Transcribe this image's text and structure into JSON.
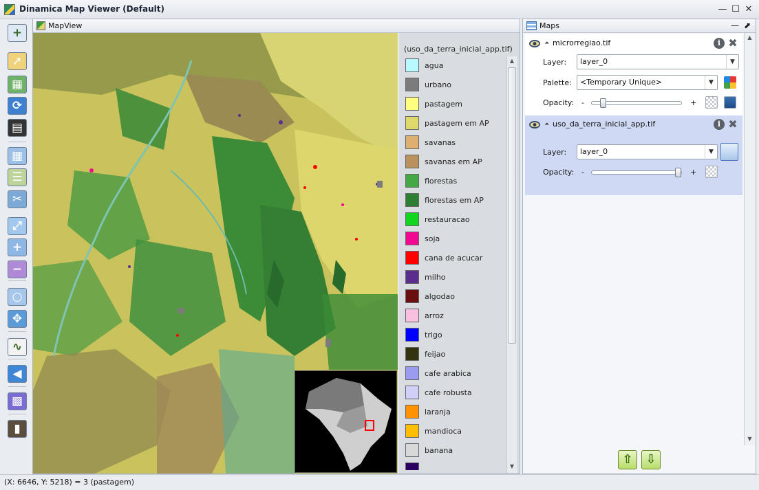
{
  "window": {
    "title": "Dinamica Map Viewer (Default)",
    "minimize_glyph": "—",
    "maximize_glyph": "☐",
    "close_glyph": "✕"
  },
  "toolbar": [
    {
      "name": "new-map-icon",
      "color": "#dfe9f5",
      "glyph": "+"
    },
    {
      "name": "open-map-icon",
      "color": "#f1d27c",
      "glyph": "➚"
    },
    {
      "name": "map-properties-icon",
      "color": "#6fb26a",
      "glyph": "▦"
    },
    {
      "name": "refresh-icon",
      "color": "#3d80cf",
      "glyph": "⟳"
    },
    {
      "name": "animation-icon",
      "color": "#333333",
      "glyph": "▤"
    },
    {
      "name": "grid-icon",
      "color": "#9cc0e8",
      "glyph": "▦"
    },
    {
      "name": "legend-icon",
      "color": "#bed39a",
      "glyph": "☰"
    },
    {
      "name": "tools-icon",
      "color": "#7ca9d6",
      "glyph": "✂"
    },
    {
      "name": "zoom-extent-icon",
      "color": "#a3c8ee",
      "glyph": "⤢"
    },
    {
      "name": "zoom-in-icon",
      "color": "#8fb7e6",
      "glyph": "+"
    },
    {
      "name": "zoom-out-icon",
      "color": "#b08ad6",
      "glyph": "−"
    },
    {
      "name": "zoom-tool-icon",
      "color": "#a6c7ea",
      "glyph": "○"
    },
    {
      "name": "pan-icon",
      "color": "#5a9bd8",
      "glyph": "✥"
    },
    {
      "name": "graph-icon",
      "color": "#f2f2f2",
      "glyph": "∿"
    },
    {
      "name": "back-icon",
      "color": "#3f86d6",
      "glyph": "◀"
    },
    {
      "name": "palette-icon",
      "color": "#7a6cd3",
      "glyph": "▩"
    },
    {
      "name": "exit-icon",
      "color": "#5b4e3e",
      "glyph": "▮"
    }
  ],
  "mapview": {
    "title": "MapView",
    "legend_title": "(uso_da_terra_inicial_app.tif)",
    "legend": [
      {
        "label": "agua",
        "color": "#b8f8ff"
      },
      {
        "label": "urbano",
        "color": "#7b7b7b"
      },
      {
        "label": "pastagem",
        "color": "#ffff7f"
      },
      {
        "label": "pastagem em AP",
        "color": "#dfd96b"
      },
      {
        "label": "savanas",
        "color": "#dfaf72"
      },
      {
        "label": "savanas em AP",
        "color": "#ba915d"
      },
      {
        "label": "florestas",
        "color": "#44a944"
      },
      {
        "label": "florestas em AP",
        "color": "#2f7f33"
      },
      {
        "label": "restauracao",
        "color": "#12d51d"
      },
      {
        "label": "soja",
        "color": "#f20890"
      },
      {
        "label": "cana de acucar",
        "color": "#ff0000"
      },
      {
        "label": "milho",
        "color": "#5a2d8f"
      },
      {
        "label": "algodao",
        "color": "#6a0f0f"
      },
      {
        "label": "arroz",
        "color": "#f9bfe0"
      },
      {
        "label": "trigo",
        "color": "#0000ff"
      },
      {
        "label": "feijao",
        "color": "#333310"
      },
      {
        "label": "cafe arabica",
        "color": "#9b9bf2"
      },
      {
        "label": "cafe robusta",
        "color": "#cfcff7"
      },
      {
        "label": "laranja",
        "color": "#ff9200"
      },
      {
        "label": "mandioca",
        "color": "#ffbf00"
      },
      {
        "label": "banana",
        "color": "#d8d8d8"
      },
      {
        "label": "",
        "color": "#2a0060"
      }
    ]
  },
  "maps_panel": {
    "title": "Maps",
    "minimize_glyph": "—",
    "restore_glyph": "⬈",
    "layers": [
      {
        "file": "microrregiao.tif",
        "layer_label": "Layer:",
        "layer_value": "layer_0",
        "palette_label": "Palette:",
        "palette_value": "<Temporary Unique>",
        "opacity_label": "Opacity:",
        "opacity": 0.1
      },
      {
        "file": "uso_da_terra_inicial_app.tif",
        "layer_label": "Layer:",
        "layer_value": "layer_0",
        "opacity_label": "Opacity:",
        "opacity": 0.98
      }
    ],
    "minus": "-",
    "plus": "+",
    "info_glyph": "i",
    "remove_glyph": "✖",
    "collapse_glyph": "⏶",
    "move_up_glyph": "⇧",
    "move_down_glyph": "⇩"
  },
  "status": {
    "text": "(X: 6646, Y: 5218) = 3 (pastagem)"
  }
}
